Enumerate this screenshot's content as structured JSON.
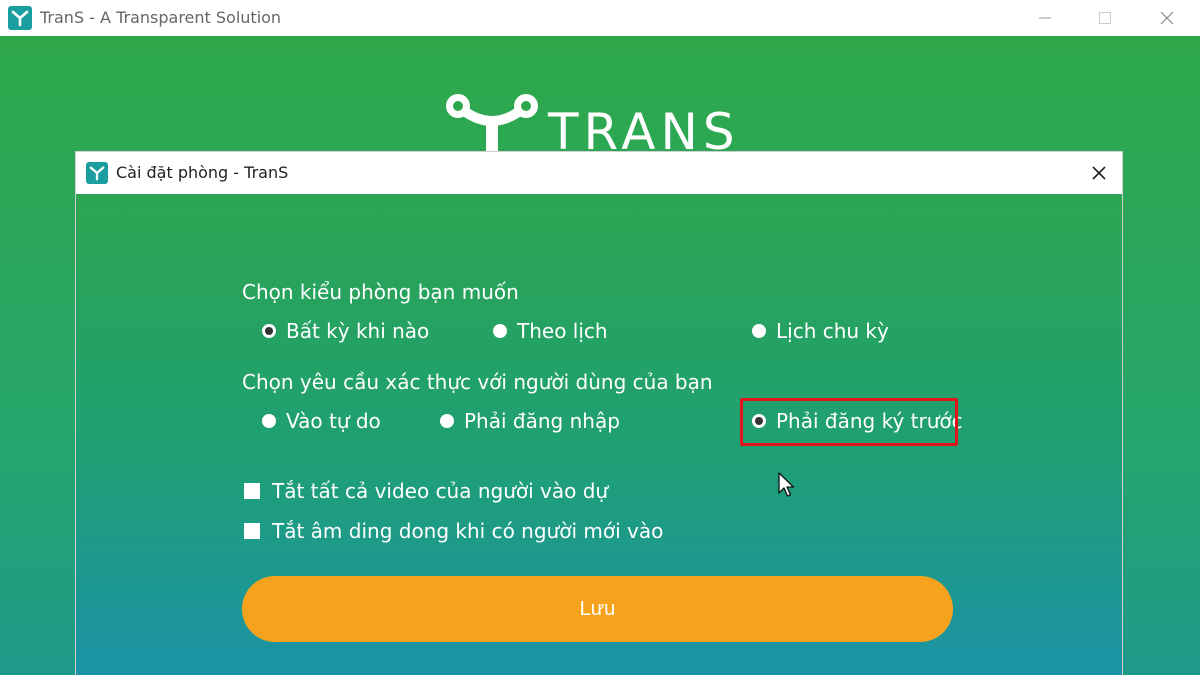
{
  "window": {
    "title": "TranS - A Transparent Solution"
  },
  "brand": {
    "text": "TRANS"
  },
  "dialog": {
    "title": "Cài đặt phòng - TranS",
    "room_type_label": "Chọn kiểu phòng bạn muốn",
    "room_type_options": [
      "Bất kỳ khi nào",
      "Theo lịch",
      "Lịch chu kỳ"
    ],
    "room_type_selected": "Bất kỳ khi nào",
    "auth_label": "Chọn yêu cầu xác thực với người dùng của bạn",
    "auth_options": [
      "Vào tự do",
      "Phải đăng nhập",
      "Phải đăng ký trước"
    ],
    "auth_selected": "Phải đăng ký trước",
    "checkbox_video": "Tắt tất cả video của người vào dự",
    "checkbox_ding": "Tắt âm ding dong khi có người mới vào",
    "save_label": "Lưu"
  },
  "colors": {
    "accent_orange": "#f7a21d",
    "highlight_red": "#e3131b",
    "brand_teal": "#1a9ea0"
  }
}
